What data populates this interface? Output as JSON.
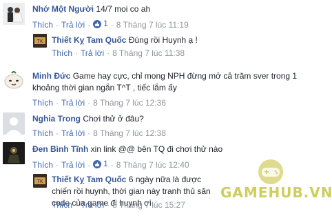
{
  "colors": {
    "author": "#365899",
    "link": "#4267b2",
    "meta": "#90949c",
    "text": "#1d2129",
    "watermark": "#c9c94a"
  },
  "comments": [
    {
      "author": "Nhớ Một Người",
      "text": "14/7 moi co ah",
      "like_label": "Thích",
      "reply_label": "Trả lời",
      "likes": "1",
      "time": "8 Tháng 7 lúc 11:19"
    },
    {
      "author": "Thiết Kỵ Tam Quốc",
      "text": "Đúng rồi Huynh ạ !",
      "like_label": "Thích",
      "reply_label": "Trả lời",
      "time": "8 Tháng 7 lúc 11:38"
    },
    {
      "author": "Minh Đức",
      "text": "Game hay cực, chỉ mong NPH đừng mở cả trăm sver trong 1 khoảng thời gian ngắn T^T , tiếc lắm ấy",
      "like_label": "Thích",
      "reply_label": "Trả lời",
      "time": "8 Tháng 7 lúc 12:36"
    },
    {
      "author": "Nghia Trong",
      "text": "Chơi thử ở đâu?",
      "like_label": "Thích",
      "reply_label": "Trả lời",
      "time": "8 Tháng 7 lúc 12:38"
    },
    {
      "author": "Đen Bình Tĩnh",
      "text": "xin link @@ bên TQ đi chơi thử nào",
      "like_label": "Thích",
      "reply_label": "Trả lời",
      "likes": "1",
      "time": "8 Tháng 7 lúc 12:40"
    },
    {
      "author": "Thiết Kỵ Tam Quốc",
      "text": "6 ngày nữa là được chiến rồi huynh, thời gian này tranh thủ săn code của game đi huynh ơi",
      "like_label": "Thích",
      "reply_label": "Trả lời",
      "time": "8 Tháng 7 lúc 15:27"
    }
  ],
  "watermark": {
    "text": "GAMEHUB.VN",
    "icon": "gamepad-icon"
  }
}
